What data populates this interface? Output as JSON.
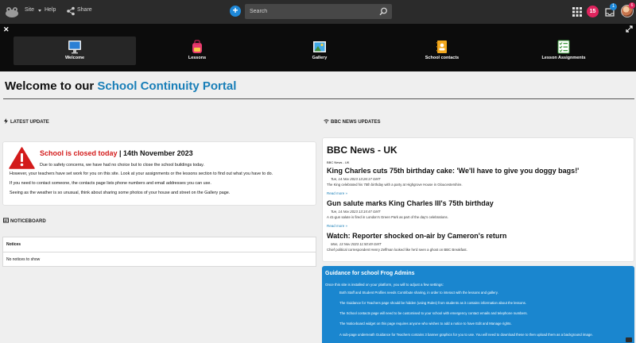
{
  "topbar": {
    "site_label": "Site",
    "help_label": "Help",
    "share_label": "Share",
    "search_placeholder": "Search",
    "notif_count": "15",
    "inbox_count": "1",
    "avatar_count": "6"
  },
  "nav": [
    {
      "label": "Welcome",
      "icon": "monitor-icon"
    },
    {
      "label": "Lessons",
      "icon": "backpack-icon"
    },
    {
      "label": "Gallery",
      "icon": "gallery-icon"
    },
    {
      "label": "School contacts",
      "icon": "contacts-book-icon"
    },
    {
      "label": "Lesson Assignments",
      "icon": "checklist-icon"
    }
  ],
  "page": {
    "title_prefix": "Welcome to our ",
    "title_accent": "School Continuity Portal"
  },
  "latest": {
    "heading": "LATEST UPDATE",
    "closed_text": "School is closed today",
    "date_text": " | 14th November 2023",
    "lines": [
      "Due to safety concerns, we have had no choice but to close the school buildings today.",
      "However, your teachers have set work for you on this site. Look at your assignments or the lessons section to find out what you have to do.",
      "If you need to contact someone, the contacts page lists phone numbers and email addresses you can use.",
      "Seeing as the weather is so unusual, think about sharing some photos of your house and street on the Gallery page."
    ]
  },
  "noticeboard": {
    "heading": "NOTICEBOARD",
    "column": "Notices",
    "empty": "No notices to show"
  },
  "bbc": {
    "heading": "BBC NEWS UPDATES",
    "title": "BBC News - UK",
    "subtitle": "BBC News - UK",
    "read_more": "Read more »",
    "items": [
      {
        "headline": "King Charles cuts 75th birthday cake: 'We'll have to give you doggy bags!'",
        "date": "Tue, 14 Nov 2023 13:26:17 GMT",
        "desc": "The King celebrated his 75th birthday with a party at Highgrove House in Gloucestershire."
      },
      {
        "headline": "Gun salute marks King Charles III's 75th birthday",
        "date": "Tue, 14 Nov 2023 13:15:47 GMT",
        "desc": "A 41-gun salute is fired in London's Green Park as part of the day's celebrations."
      },
      {
        "headline": "Watch: Reporter shocked on-air by Cameron's return",
        "date": "Mon, 13 Nov 2023 11:50:49 GMT",
        "desc": "Chief political correspondent Henry Zeffman looked like he'd seen a ghost on BBC Breakfast."
      }
    ]
  },
  "guidance": {
    "title": "Guidance for school Frog Admins",
    "intro": "Once this site is installed on your platform, you will to adjust a few settings:",
    "items": [
      "Both Staff and Student Profiles needs Contribute sharing, in order to interact with the lessons and gallery.",
      "The Guidance for Teachers page should be hidden (using Rules) from students as it contains information about the lessons.",
      "The School contacts page will need to be customised to your school with emergency contact emails and telephone numbers.",
      "The Noticeboard widget on this page requires anyone who wishes to add a notice to have Edit and Manage rights.",
      "A sub-page underneath Guidance for Teachers contains 3 banner graphics for you to use.  You will need to download these to then upload them as a background image."
    ]
  },
  "colors": {
    "accent_blue": "#1a7fb8",
    "alert_red": "#d31b1b",
    "guidance_bg": "#1a86cf",
    "badge_pink": "#e0245e"
  }
}
